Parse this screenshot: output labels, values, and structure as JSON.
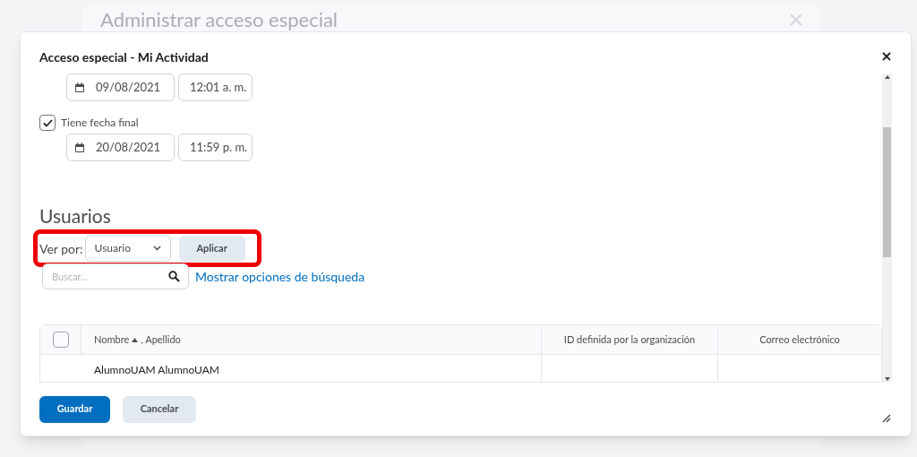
{
  "background_dialog": {
    "title": "Administrar acceso especial"
  },
  "dialog": {
    "title": "Acceso especial - Mi Actividad"
  },
  "start": {
    "date": "09/08/2021",
    "time": "12:01 a. m."
  },
  "end_option": {
    "label": "Tiene fecha final",
    "checked": true
  },
  "end": {
    "date": "20/08/2021",
    "time": "11:59 p. m."
  },
  "users": {
    "heading": "Usuarios",
    "view_by_label": "Ver por:",
    "view_by_value": "Usuario",
    "apply_button": "Aplicar",
    "search_placeholder": "Buscar...",
    "search_options_link": "Mostrar opciones de búsqueda"
  },
  "table": {
    "select_all_checked": false,
    "columns": [
      {
        "label": "Nombre",
        "secondary": ", Apellido",
        "sorted": true
      },
      {
        "label": "ID definida por la organización",
        "sorted": false
      },
      {
        "label": "Correo electrónico",
        "sorted": false
      }
    ],
    "rows": [
      [
        "AlumnoUAM AlumnoUAM",
        "",
        ""
      ]
    ]
  },
  "buttons": [
    {
      "label": "Guardar",
      "kind": "primary"
    },
    {
      "label": "Cancelar",
      "kind": "secondary"
    }
  ]
}
